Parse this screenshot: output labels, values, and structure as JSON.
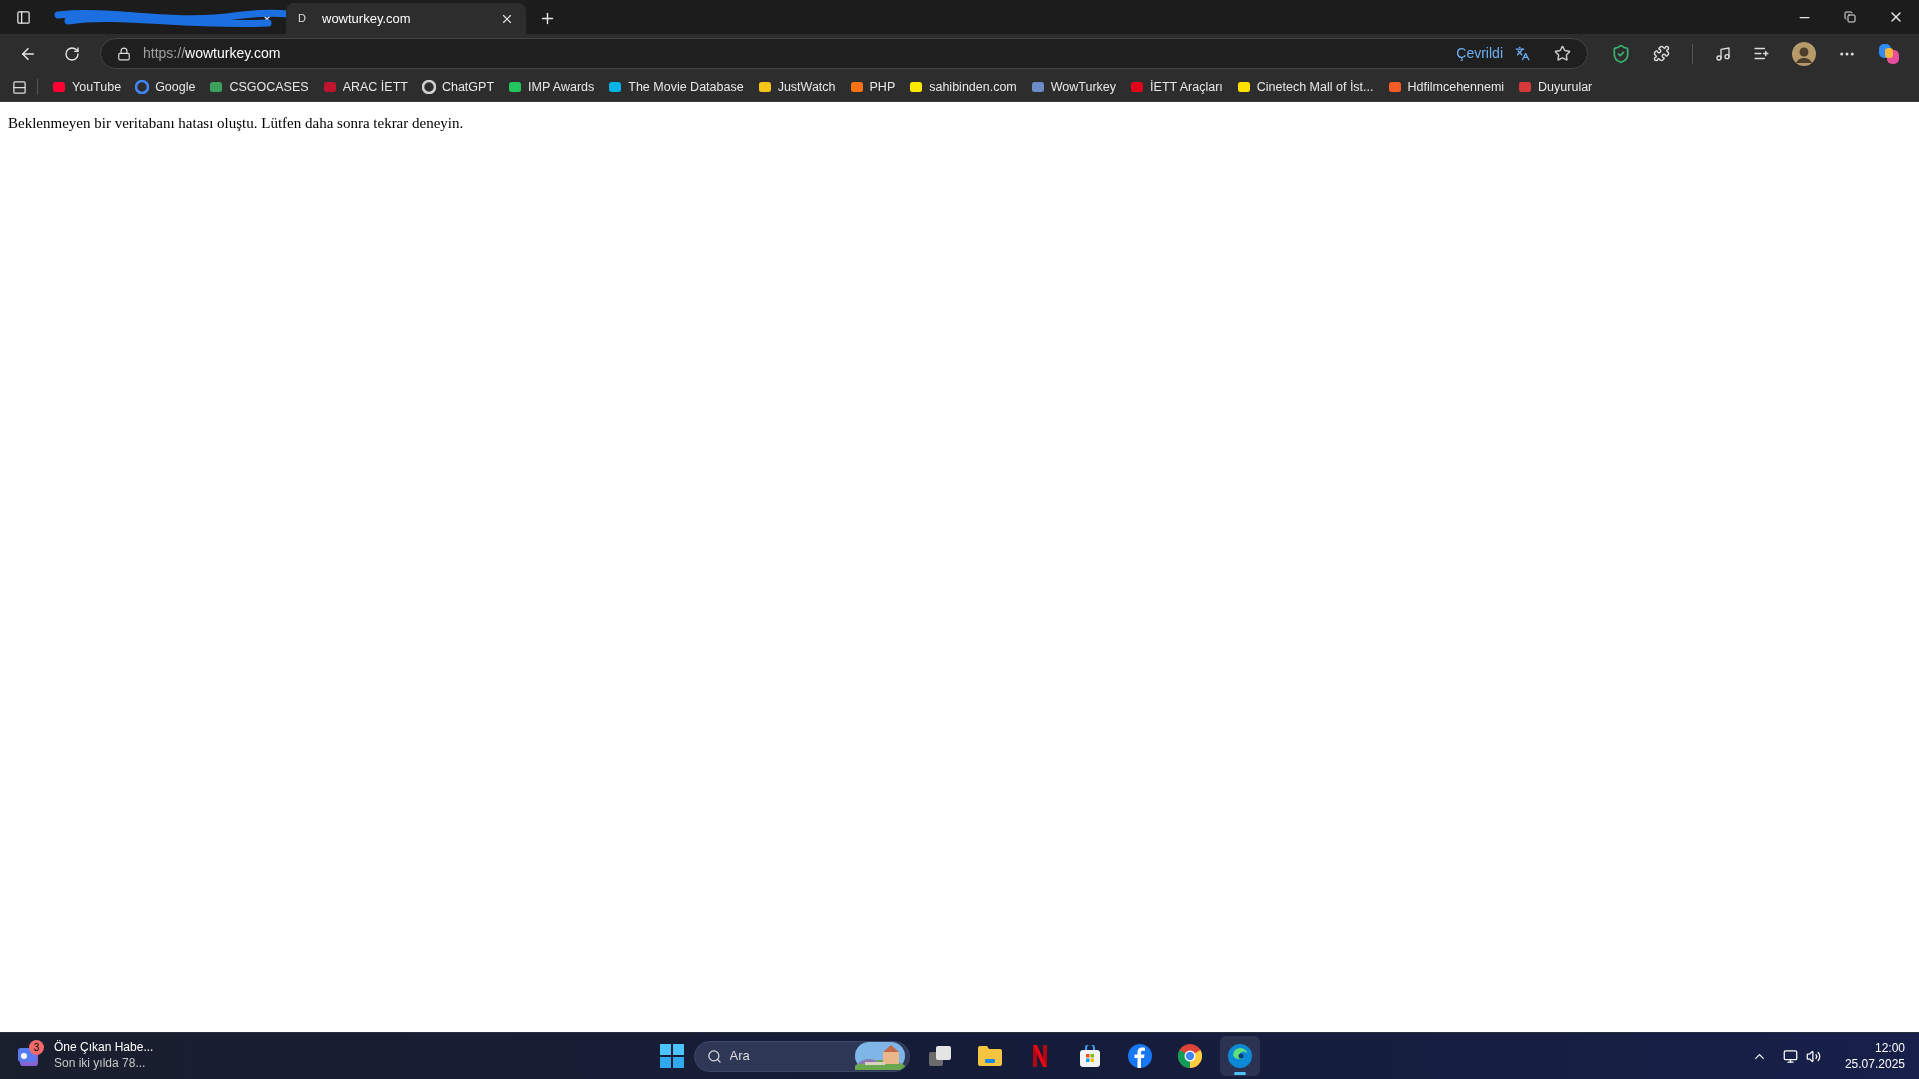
{
  "tabs": [
    {
      "selected": false
    },
    {
      "favicon": "D",
      "title": "wowturkey.com",
      "selected": true
    }
  ],
  "address": {
    "scheme": "https://",
    "host": "wowturkey.com",
    "translation": "Çevrildi"
  },
  "bookmarks": [
    "YouTube",
    "Google",
    "CSGOCASES",
    "ARAC İETT",
    "ChatGPT",
    "IMP Awards",
    "The Movie Database",
    "JustWatch",
    "PHP",
    "sahibinden.com",
    "WowTurkey",
    "İETT Araçları",
    "Cinetech Mall of İst...",
    "Hdfilmcehennemi",
    "Duyurular"
  ],
  "page": {
    "message": "Beklenmeyen bir veritabanı hatası oluştu. Lütfen daha sonra tekrar deneyin."
  },
  "taskbar": {
    "widget": {
      "badge": "3",
      "title": "Öne Çıkan Habe...",
      "subtitle": "Son iki yılda 78..."
    },
    "search": {
      "placeholder": "Ara"
    },
    "apps": [
      {
        "kind": "taskview",
        "selected": false
      },
      {
        "kind": "explorer",
        "selected": false
      },
      {
        "kind": "netflix",
        "selected": false
      },
      {
        "kind": "store",
        "selected": false
      },
      {
        "kind": "facebook",
        "selected": false
      },
      {
        "kind": "chrome",
        "selected": false
      },
      {
        "kind": "edge",
        "selected": true
      }
    ],
    "time": "12:00",
    "date": "25.07.2025"
  }
}
